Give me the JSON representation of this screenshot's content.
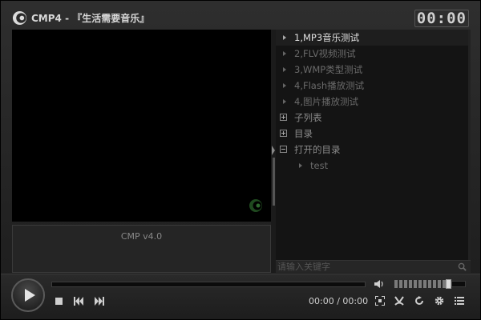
{
  "window": {
    "title": "CMP4 - 『生活需要音乐』",
    "clock": "00:00"
  },
  "video": {
    "info_text": "CMP v4.0"
  },
  "playlist": {
    "items": [
      {
        "label": "1,MP3音乐测试",
        "active": true
      },
      {
        "label": "2,FLV视频测试",
        "active": false
      },
      {
        "label": "3,WMP类型测试",
        "active": false
      },
      {
        "label": "4,Flash播放测试",
        "active": false
      },
      {
        "label": "4,图片播放测试",
        "active": false
      }
    ],
    "folders": [
      {
        "label": "子列表",
        "expanded": false
      },
      {
        "label": "目录",
        "expanded": false
      },
      {
        "label": "打开的目录",
        "expanded": true
      }
    ],
    "sub_items": [
      {
        "label": "test"
      }
    ]
  },
  "search": {
    "placeholder": "请输入关键字",
    "value": ""
  },
  "controls": {
    "time": "00:00 / 00:00",
    "volume_level": 0.78,
    "progress": 0
  },
  "icons": {
    "logo": "cmp-logo-icon",
    "play": "play-icon",
    "stop": "stop-icon",
    "prev": "previous-icon",
    "next": "next-icon",
    "volume": "volume-icon",
    "fullscreen": "fullscreen-icon",
    "share": "share-icon",
    "repeat": "repeat-icon",
    "settings": "gear-icon",
    "playlist": "playlist-icon",
    "search": "search-icon"
  },
  "colors": {
    "background": "#1a1a1a",
    "video": "#000000",
    "active_text": "#e0e0e0",
    "inactive_text": "#6a6a6a"
  }
}
